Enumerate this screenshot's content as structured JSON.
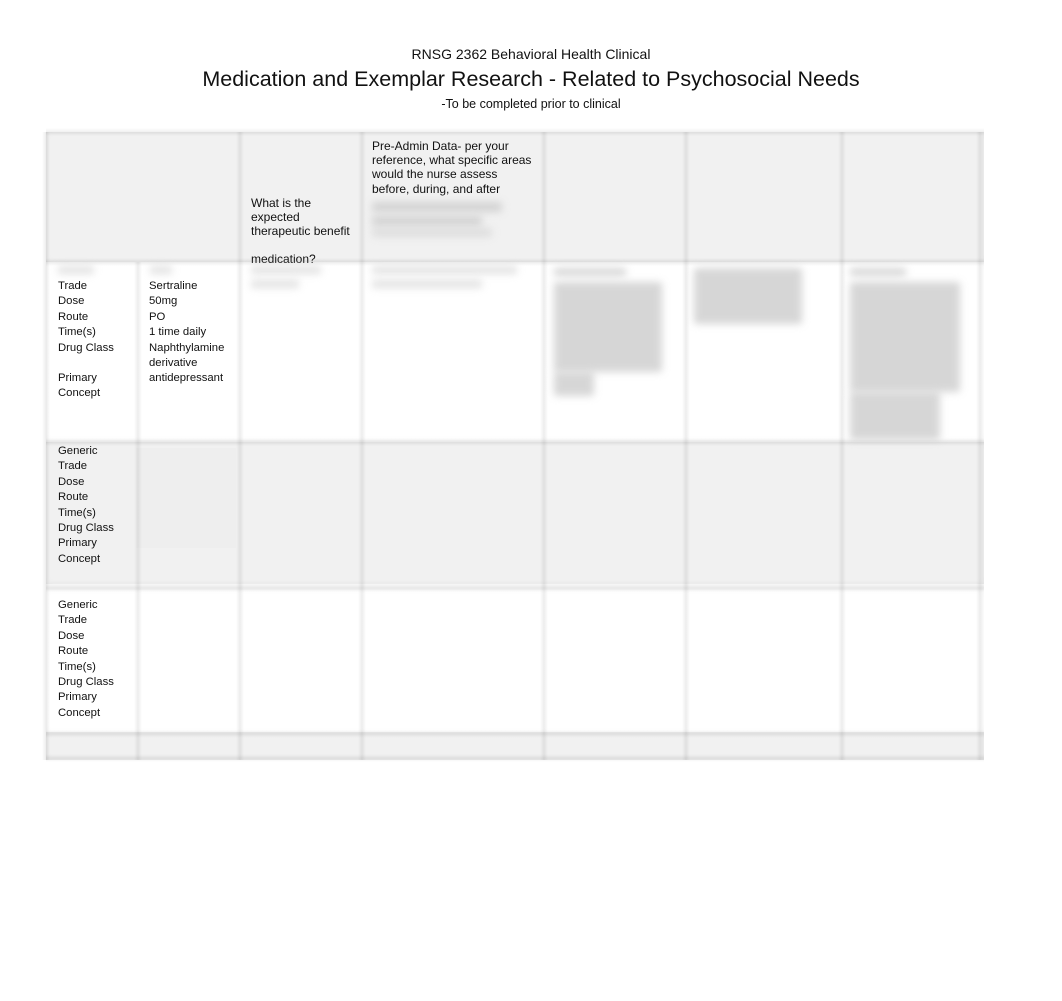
{
  "header": {
    "course": "RNSG 2362 Behavioral Health Clinical",
    "title": "Medication and Exemplar Research - Related to Psychosocial Needs",
    "subtitle": "-To be completed prior to clinical"
  },
  "table": {
    "column_headers": [
      {
        "text": "",
        "obscured": true
      },
      {
        "text": "",
        "obscured": true
      },
      {
        "lines": [
          "What is the",
          "expected",
          "therapeutic benefit",
          "",
          "medication?"
        ],
        "obscured_partially": true
      },
      {
        "lines": [
          "Pre-Admin Data- per your",
          "reference, what specific areas",
          "would the nurse assess",
          "before, during, and after"
        ],
        "obscured_partially": true
      },
      {
        "text": "",
        "obscured": true
      },
      {
        "text": "",
        "obscured": true
      },
      {
        "text": "",
        "obscured": true
      }
    ],
    "rows": [
      {
        "labels": [
          "Trade",
          "Dose",
          "Route",
          "Time(s)",
          "Drug Class",
          "",
          "Primary",
          "Concept"
        ],
        "values": [
          "Sertraline",
          "50mg",
          "PO",
          "1 time daily",
          "Naphthylamine",
          "derivative",
          "antidepressant",
          ""
        ],
        "other_cells_obscured": true
      },
      {
        "labels": [
          "Generic",
          "Trade",
          "Dose",
          "Route",
          "Time(s)",
          "Drug Class",
          "Primary",
          "Concept"
        ],
        "values": [],
        "other_cells_obscured": false
      },
      {
        "labels": [
          "Generic",
          "Trade",
          "Dose",
          "Route",
          "Time(s)",
          "Drug Class",
          "Primary",
          "Concept"
        ],
        "values": [],
        "other_cells_obscured": false
      }
    ]
  }
}
